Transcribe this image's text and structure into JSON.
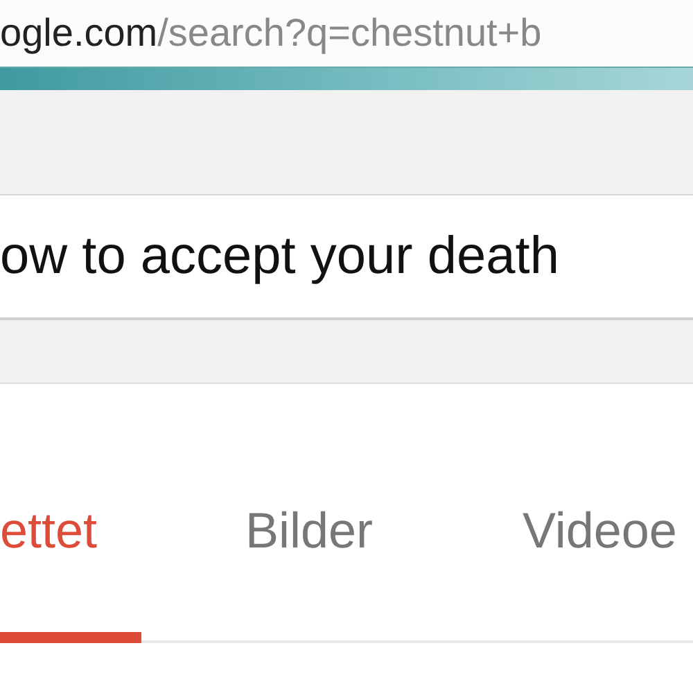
{
  "address_bar": {
    "host": "ogle.com",
    "path": "/search?q=chestnut+b"
  },
  "search": {
    "value": "ow to accept your death"
  },
  "tabs": [
    {
      "label": "ettet",
      "selected": true
    },
    {
      "label": "Bilder",
      "selected": false
    },
    {
      "label": "Videoe",
      "selected": false
    }
  ]
}
